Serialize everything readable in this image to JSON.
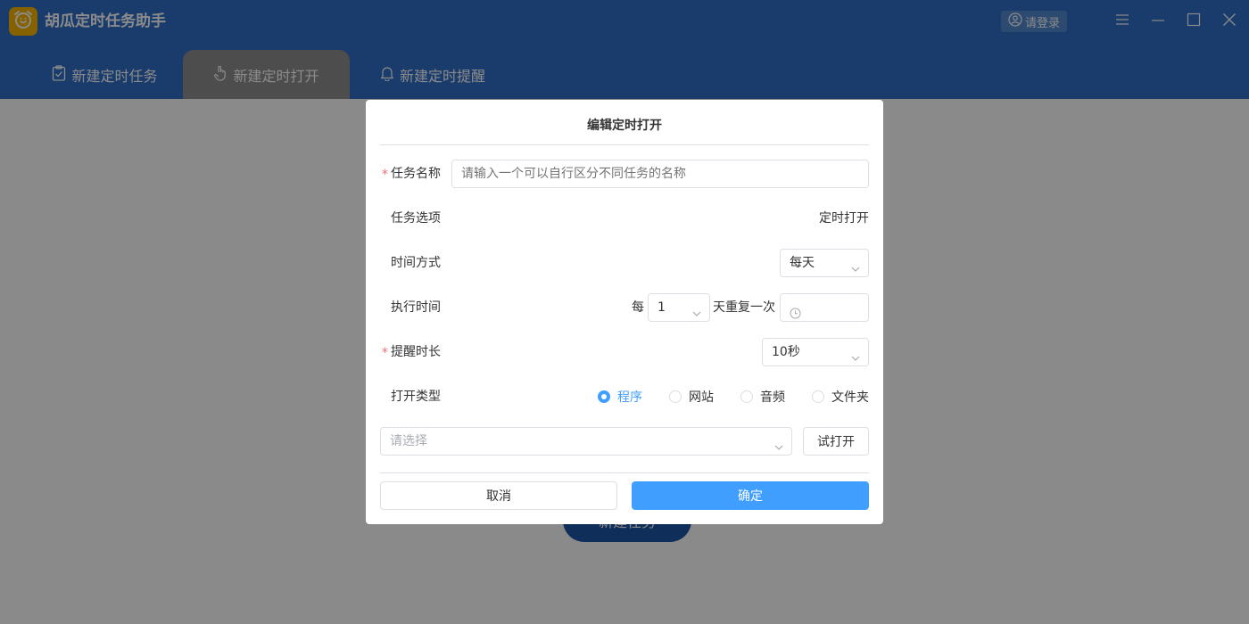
{
  "app": {
    "title": "胡瓜定时任务助手",
    "login_label": "请登录",
    "logo_icon": "alarm-clock-icon"
  },
  "window_controls": [
    "menu-icon",
    "minimize-icon",
    "maximize-icon",
    "close-icon"
  ],
  "tabs": [
    {
      "label": "新建定时任务",
      "icon": "clipboard-check-icon",
      "active": false
    },
    {
      "label": "新建定时打开",
      "icon": "pointer-hand-icon",
      "active": true
    },
    {
      "label": "新建定时提醒",
      "icon": "bell-icon",
      "active": false
    }
  ],
  "background": {
    "new_task_button": "新建任务"
  },
  "dialog": {
    "title": "编辑定时打开",
    "task_name": {
      "label": "任务名称",
      "placeholder": "请输入一个可以自行区分不同任务的名称",
      "value": ""
    },
    "task_option": {
      "label": "任务选项",
      "value": "定时打开"
    },
    "time_mode": {
      "label": "时间方式",
      "value": "每天"
    },
    "exec_time": {
      "label": "执行时间",
      "prefix": "每",
      "interval": "1",
      "suffix": "天重复一次",
      "time_value": ""
    },
    "reminder_duration": {
      "label": "提醒时长",
      "value": "10秒"
    },
    "open_type": {
      "label": "打开类型",
      "options": [
        "程序",
        "网站",
        "音频",
        "文件夹"
      ],
      "selected": "程序"
    },
    "target_select": {
      "placeholder": "请选择"
    },
    "try_open_label": "试打开",
    "cancel_label": "取消",
    "confirm_label": "确定"
  },
  "colors": {
    "header": "#2f6fc7",
    "accent": "#409eff",
    "required": "#f56c6c",
    "logo": "#f6b400"
  }
}
